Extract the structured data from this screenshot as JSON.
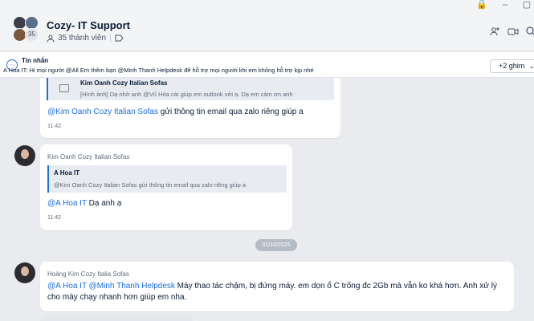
{
  "window": {
    "lock_glyph": "🔒",
    "minimize_glyph": "–",
    "restore_glyph": "▢"
  },
  "header": {
    "title": "Cozy- IT Support",
    "member_avatar_count": "35",
    "member_count": "35 thành viên",
    "add_member_icon": "add-member-icon",
    "video_icon": "video-call-icon",
    "search_icon": "search-icon"
  },
  "pinned": {
    "label": "Tin nhắn",
    "text": "A Hoa IT: Hi mọi người @All  Em thêm bạn @Minh Thanh Helpdesk để hỗ trợ mọi người khi em không hỗ trợ kịp nhé",
    "more": "+2 ghim"
  },
  "messages": [
    {
      "quote_title": "Kim Oanh Cozy Italian Sofas",
      "quote_text": "[Hình ảnh] Dạ nhờ anh @Vũ Hòa cài giúp em outlook với ạ. Dạ em cảm ơn anh",
      "mention": "@Kim Oanh Cozy Italian Sofas",
      "text": " gửi thông tin email qua zalo riêng giúp a",
      "time": "11:42"
    },
    {
      "sender": "Kim Oanh Cozy Italian Sofas",
      "quote_title": "A Hoa IT",
      "quote_text": "@Kim Oanh Cozy Italian Sofas gửi thông tin email qua zalo riêng giúp a",
      "mention": "@A Hoa IT",
      "text": " Dạ anh ạ",
      "time": "11:42"
    },
    {
      "sender": "Hoàng Kim Cozy Italia Sofas",
      "mention": "@A Hoa IT @Minh Thanh Helpdesk",
      "text": " Máy thao tác chậm, bị đứng máy. em dọn ổ C trống đc 2Gb mà vẫn ko khá hơn. Anh xử lý cho máy chạy nhanh hơn giúp em nha."
    }
  ],
  "date_divider": "01/10/2025"
}
